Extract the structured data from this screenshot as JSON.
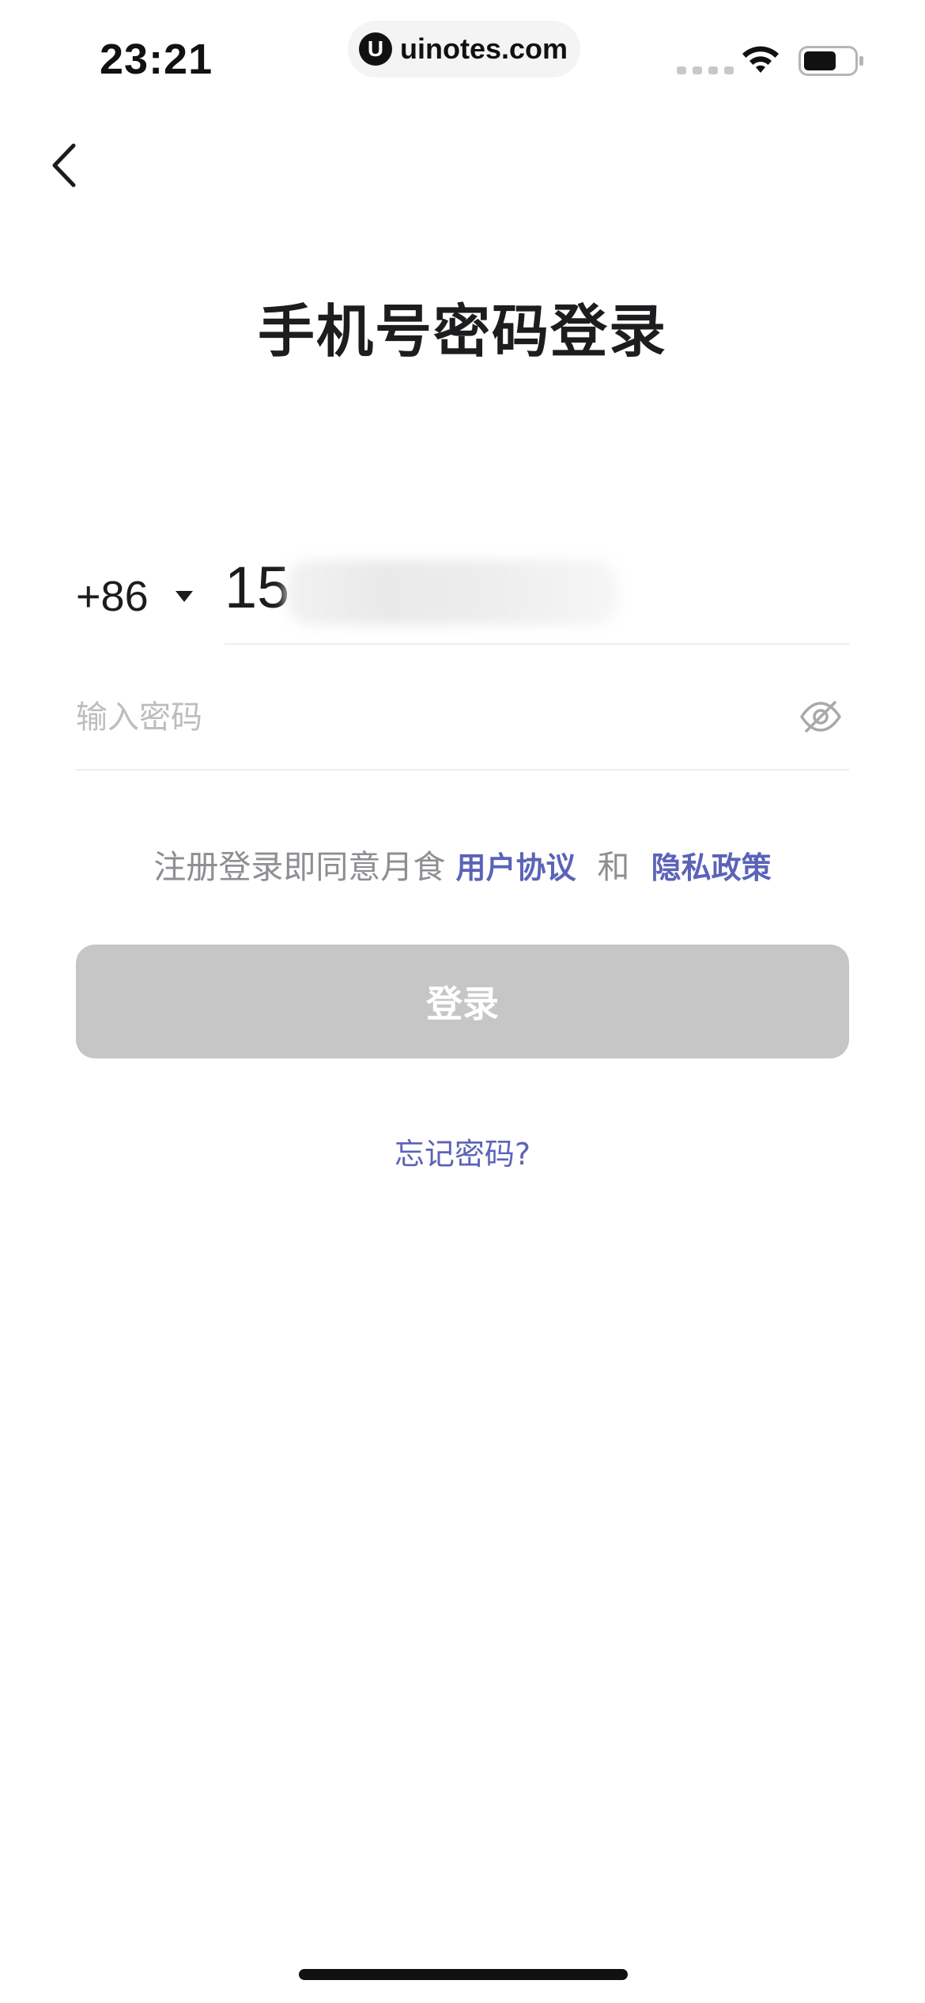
{
  "status_bar": {
    "time": "23:21",
    "url": "uinotes.com",
    "url_logo_letter": "U"
  },
  "header": {
    "title": "手机号密码登录"
  },
  "phone": {
    "country_code": "+86",
    "value_visible": "15"
  },
  "password": {
    "placeholder": "输入密码"
  },
  "agreement": {
    "prefix": "注册登录即同意月食",
    "user_agreement": "用户协议",
    "and": "和",
    "privacy_policy": "隐私政策"
  },
  "login_button": {
    "label": "登录"
  },
  "forgot_password": {
    "label": "忘记密码?"
  },
  "colors": {
    "link": "#5b63b8",
    "button_disabled": "#c6c6c6",
    "placeholder": "#bdbdbd",
    "divider": "#eeeeee"
  }
}
